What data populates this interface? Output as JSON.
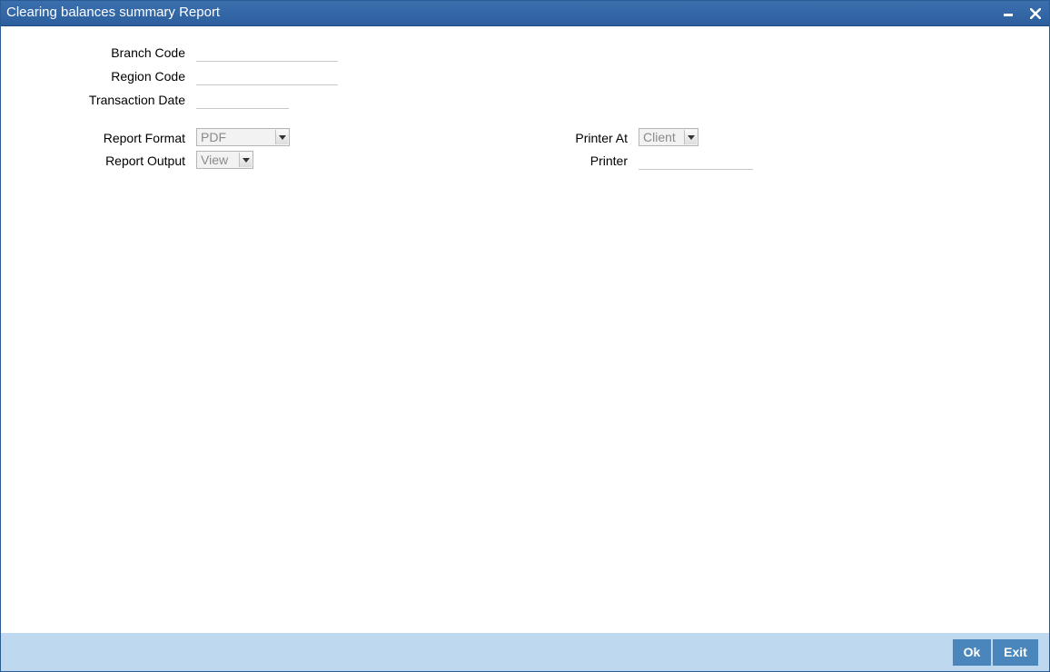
{
  "window": {
    "title": "Clearing balances summary Report"
  },
  "form": {
    "branch_code_label": "Branch Code",
    "branch_code_value": "",
    "region_code_label": "Region Code",
    "region_code_value": "",
    "transaction_date_label": "Transaction Date",
    "transaction_date_value": "",
    "report_format_label": "Report Format",
    "report_format_value": "PDF",
    "report_output_label": "Report Output",
    "report_output_value": "View",
    "printer_at_label": "Printer At",
    "printer_at_value": "Client",
    "printer_label": "Printer",
    "printer_value": ""
  },
  "footer": {
    "ok_label": "Ok",
    "exit_label": "Exit"
  },
  "icons": {
    "minimize": "minimize-icon",
    "close": "close-icon",
    "dropdown": "dropdown-arrow-icon"
  },
  "colors": {
    "titlebar": "#2d5f9e",
    "footer": "#bed9ef",
    "button": "#4a86bc"
  }
}
